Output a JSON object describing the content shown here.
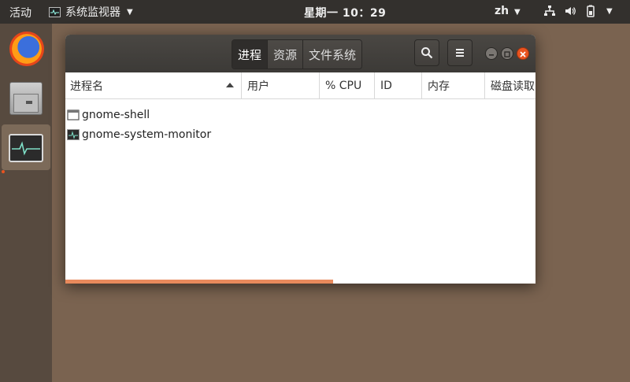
{
  "topbar": {
    "activities": "活动",
    "app_name": "系统监视器",
    "clock": "星期一 10：29",
    "lang": "zh",
    "tray_icons": [
      "network-icon",
      "volume-icon",
      "battery-icon",
      "system-menu-caret-icon"
    ]
  },
  "dock": {
    "items": [
      {
        "name": "firefox",
        "icon": "firefox-icon"
      },
      {
        "name": "files",
        "icon": "file-cabinet-icon"
      },
      {
        "name": "system-monitor",
        "icon": "system-monitor-icon",
        "active": true
      }
    ]
  },
  "window": {
    "tabs": [
      {
        "label": "进程",
        "active": true
      },
      {
        "label": "资源",
        "active": false
      },
      {
        "label": "文件系统",
        "active": false
      }
    ],
    "buttons": [
      "search-icon",
      "hamburger-menu-icon"
    ],
    "window_controls": [
      "minimize-icon",
      "maximize-icon",
      "close-icon"
    ],
    "columns": [
      "进程名",
      "用户",
      "% CPU",
      "ID",
      "内存",
      "磁盘读取"
    ],
    "sorted_column": "进程名",
    "rows": [
      {
        "name": "gnome-shell",
        "icon": "window-icon"
      },
      {
        "name": "gnome-system-monitor",
        "icon": "system-monitor-icon"
      }
    ],
    "progress_fraction": 0.57
  },
  "colors": {
    "desktop": "#7a6350",
    "topbar": "#33302d",
    "accent": "#e95420",
    "headerbar": "#3c3a37"
  }
}
